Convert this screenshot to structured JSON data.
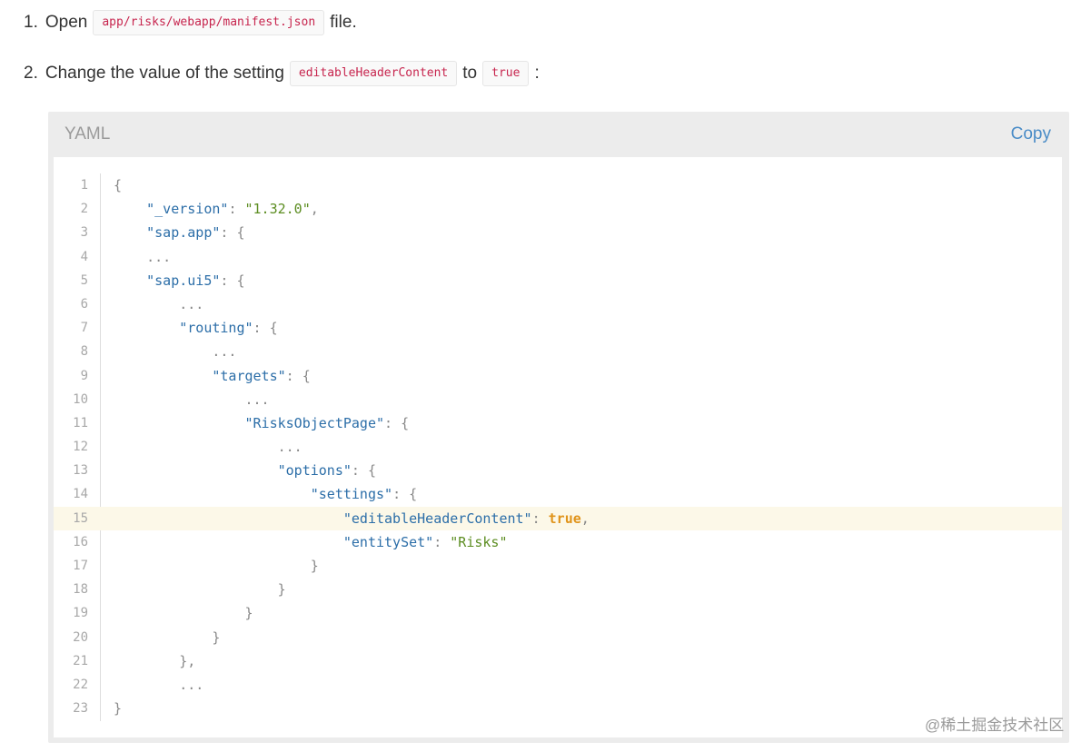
{
  "steps": [
    {
      "number": "1.",
      "text_before": "Open",
      "code": "app/risks/webapp/manifest.json",
      "text_after": "file."
    },
    {
      "number": "2.",
      "text_before": "Change the value of the setting",
      "code": "editableHeaderContent",
      "text_middle": "to",
      "code2": "true",
      "text_after": ":"
    }
  ],
  "code_block": {
    "language": "YAML",
    "copy_label": "Copy",
    "highlighted_line": 15,
    "lines": [
      {
        "n": "1",
        "indent": "",
        "tokens": [
          {
            "t": "p",
            "v": "{"
          }
        ]
      },
      {
        "n": "2",
        "indent": "    ",
        "tokens": [
          {
            "t": "k",
            "v": "\"_version\""
          },
          {
            "t": "p",
            "v": ": "
          },
          {
            "t": "s",
            "v": "\"1.32.0\""
          },
          {
            "t": "p",
            "v": ","
          }
        ]
      },
      {
        "n": "3",
        "indent": "    ",
        "tokens": [
          {
            "t": "k",
            "v": "\"sap.app\""
          },
          {
            "t": "p",
            "v": ": {"
          }
        ]
      },
      {
        "n": "4",
        "indent": "    ",
        "tokens": [
          {
            "t": "p",
            "v": "..."
          }
        ]
      },
      {
        "n": "5",
        "indent": "    ",
        "tokens": [
          {
            "t": "k",
            "v": "\"sap.ui5\""
          },
          {
            "t": "p",
            "v": ": {"
          }
        ]
      },
      {
        "n": "6",
        "indent": "        ",
        "tokens": [
          {
            "t": "p",
            "v": "..."
          }
        ]
      },
      {
        "n": "7",
        "indent": "        ",
        "tokens": [
          {
            "t": "k",
            "v": "\"routing\""
          },
          {
            "t": "p",
            "v": ": {"
          }
        ]
      },
      {
        "n": "8",
        "indent": "            ",
        "tokens": [
          {
            "t": "p",
            "v": "..."
          }
        ]
      },
      {
        "n": "9",
        "indent": "            ",
        "tokens": [
          {
            "t": "k",
            "v": "\"targets\""
          },
          {
            "t": "p",
            "v": ": {"
          }
        ]
      },
      {
        "n": "10",
        "indent": "                ",
        "tokens": [
          {
            "t": "p",
            "v": "..."
          }
        ]
      },
      {
        "n": "11",
        "indent": "                ",
        "tokens": [
          {
            "t": "k",
            "v": "\"RisksObjectPage\""
          },
          {
            "t": "p",
            "v": ": {"
          }
        ]
      },
      {
        "n": "12",
        "indent": "                    ",
        "tokens": [
          {
            "t": "p",
            "v": "..."
          }
        ]
      },
      {
        "n": "13",
        "indent": "                    ",
        "tokens": [
          {
            "t": "k",
            "v": "\"options\""
          },
          {
            "t": "p",
            "v": ": {"
          }
        ]
      },
      {
        "n": "14",
        "indent": "                        ",
        "tokens": [
          {
            "t": "k",
            "v": "\"settings\""
          },
          {
            "t": "p",
            "v": ": {"
          }
        ]
      },
      {
        "n": "15",
        "indent": "                            ",
        "tokens": [
          {
            "t": "k",
            "v": "\"editableHeaderContent\""
          },
          {
            "t": "p",
            "v": ": "
          },
          {
            "t": "b",
            "v": "true"
          },
          {
            "t": "p",
            "v": ","
          }
        ]
      },
      {
        "n": "16",
        "indent": "                            ",
        "tokens": [
          {
            "t": "k",
            "v": "\"entitySet\""
          },
          {
            "t": "p",
            "v": ": "
          },
          {
            "t": "s",
            "v": "\"Risks\""
          }
        ]
      },
      {
        "n": "17",
        "indent": "                        ",
        "tokens": [
          {
            "t": "p",
            "v": "}"
          }
        ]
      },
      {
        "n": "18",
        "indent": "                    ",
        "tokens": [
          {
            "t": "p",
            "v": "}"
          }
        ]
      },
      {
        "n": "19",
        "indent": "                ",
        "tokens": [
          {
            "t": "p",
            "v": "}"
          }
        ]
      },
      {
        "n": "20",
        "indent": "            ",
        "tokens": [
          {
            "t": "p",
            "v": "}"
          }
        ]
      },
      {
        "n": "21",
        "indent": "        ",
        "tokens": [
          {
            "t": "p",
            "v": "},"
          }
        ]
      },
      {
        "n": "22",
        "indent": "        ",
        "tokens": [
          {
            "t": "p",
            "v": "..."
          }
        ]
      },
      {
        "n": "23",
        "indent": "",
        "tokens": [
          {
            "t": "p",
            "v": "}"
          }
        ]
      }
    ]
  },
  "watermark": "@稀土掘金技术社区",
  "colors": {
    "key": "#2c6ea8",
    "string": "#5c8d21",
    "boolean": "#e0941b",
    "punctuation": "#888888",
    "inline_code": "#c7254e",
    "copy_link": "#4a8cc7",
    "highlight": "#fcf8e8"
  }
}
